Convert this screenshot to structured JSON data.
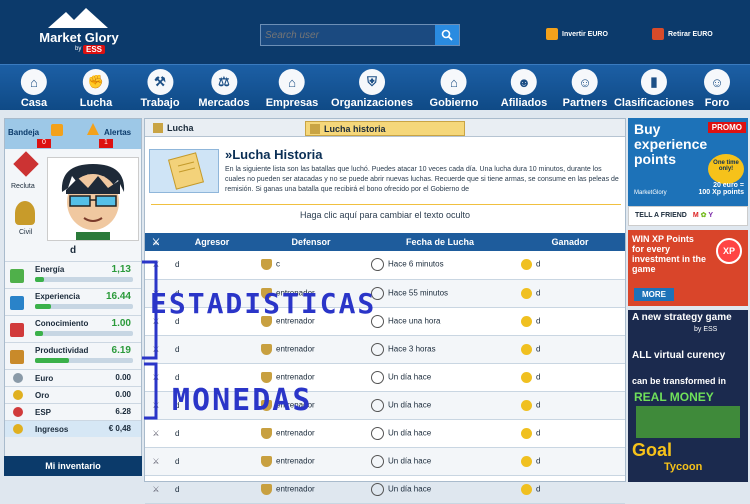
{
  "header": {
    "logo_name": "Market Glory",
    "logo_by": "by",
    "logo_ess": "ESS",
    "search_placeholder": "Search user",
    "invest_label": "Invertir EURO",
    "withdraw_label": "Retirar EURO"
  },
  "nav": [
    {
      "label": "Casa",
      "icon": "house-icon",
      "glyph": "⌂"
    },
    {
      "label": "Lucha",
      "icon": "fight-icon",
      "glyph": "✊"
    },
    {
      "label": "Trabajo",
      "icon": "work-icon",
      "glyph": "⚒"
    },
    {
      "label": "Mercados",
      "icon": "market-icon",
      "glyph": "⚖"
    },
    {
      "label": "Empresas",
      "icon": "factory-icon",
      "glyph": "⌂"
    },
    {
      "label": "Organizaciones",
      "icon": "shield-icon",
      "glyph": "⛨"
    },
    {
      "label": "Gobierno",
      "icon": "government-icon",
      "glyph": "⌂"
    },
    {
      "label": "Afiliados",
      "icon": "affiliates-icon",
      "glyph": "☻"
    },
    {
      "label": "Partners",
      "icon": "partners-icon",
      "glyph": "☺"
    },
    {
      "label": "Clasificaciones",
      "icon": "rankings-icon",
      "glyph": "▮"
    },
    {
      "label": "Foro",
      "icon": "forum-icon",
      "glyph": "☺"
    }
  ],
  "sidebar": {
    "inbox_label": "Bandeja",
    "inbox_count": "0",
    "alerts_label": "Alertas",
    "alerts_count": "1",
    "rank1_label": "Recluta",
    "rank2_label": "Civil",
    "username": "d",
    "stats": [
      {
        "label": "Energía",
        "value": "1,13",
        "fill": 0.09,
        "color": "#4fb04a"
      },
      {
        "label": "Experiencia",
        "value": "16.44",
        "fill": 0.16,
        "color": "#2a83c9"
      },
      {
        "label": "Conocimiento",
        "value": "1.00",
        "fill": 0.08,
        "color": "#d13b3b"
      },
      {
        "label": "Productividad",
        "value": "6.19",
        "fill": 0.35,
        "color": "#c98a2a"
      }
    ],
    "currencies": [
      {
        "label": "Euro",
        "value": "0.00",
        "color": "#8a9aa8"
      },
      {
        "label": "Oro",
        "value": "0.00",
        "color": "#e0b020"
      },
      {
        "label": "ESP",
        "value": "6.28",
        "color": "#d13b3b"
      },
      {
        "label": "Ingresos",
        "value": "€ 0,48",
        "color": "#e0b020"
      }
    ],
    "inventory_label": "Mi inventario"
  },
  "main": {
    "tab_fight": "Lucha",
    "tab_history": "Lucha historia",
    "title": "»Lucha Historia",
    "description": "En la siguiente lista son las batallas que luchó. Puedes atacar 10 veces cada día. Una lucha dura 10 minutos, durante los cuales no pueden ser atacadas y no se puede abrir nuevas luchas. Recuerde que si tiene armas, se consume en las peleas de remisión. Si ganas una batalla que recibirá el bono ofrecido por el Gobierno de",
    "click_text": "Haga clic aquí para cambiar el texto oculto",
    "columns": [
      "Agresor",
      "Defensor",
      "Fecha de Lucha",
      "Ganador"
    ],
    "rows": [
      {
        "aggressor": "d",
        "defender": "c",
        "date": "Hace 6 minutos",
        "winner": "d"
      },
      {
        "aggressor": "d",
        "defender": "entrenador",
        "date": "Hace 55 minutos",
        "winner": "d"
      },
      {
        "aggressor": "d",
        "defender": "entrenador",
        "date": "Hace una hora",
        "winner": "d"
      },
      {
        "aggressor": "d",
        "defender": "entrenador",
        "date": "Hace 3 horas",
        "winner": "d"
      },
      {
        "aggressor": "d",
        "defender": "entrenador",
        "date": "Un día hace",
        "winner": "d"
      },
      {
        "aggressor": "d",
        "defender": "entrenador",
        "date": "Un día hace",
        "winner": "d"
      },
      {
        "aggressor": "d",
        "defender": "entrenador",
        "date": "Un día hace",
        "winner": "d"
      },
      {
        "aggressor": "d",
        "defender": "entrenador",
        "date": "Un día hace",
        "winner": "d"
      },
      {
        "aggressor": "d",
        "defender": "entrenador",
        "date": "Un día hace",
        "winner": "d"
      }
    ]
  },
  "annotations": {
    "stats": "ESTADISTICAS",
    "money": "MONEDAS"
  },
  "ads": {
    "ad1_title": "Buy experience points",
    "promo": "PROMO",
    "one_time": "One time only!",
    "ad1_equation_1": "20 euro =",
    "ad1_equation_2": "100 Xp points",
    "ad1_brand": "MarketGlory",
    "tell_friend": "TELL A FRIEND",
    "ad2_title": "WIN XP Points for every investment in the game",
    "ad2_badge": "XP",
    "ad2_more": "MORE",
    "ad3_l1": "A new strategy game",
    "ad3_by": "by ESS",
    "ad3_l2": "ALL virtual curency",
    "ad3_l3": "can be transformed in",
    "ad3_l4": "REAL MONEY",
    "ad3_l5": "Goal",
    "ad3_l6": "Tycoon"
  }
}
